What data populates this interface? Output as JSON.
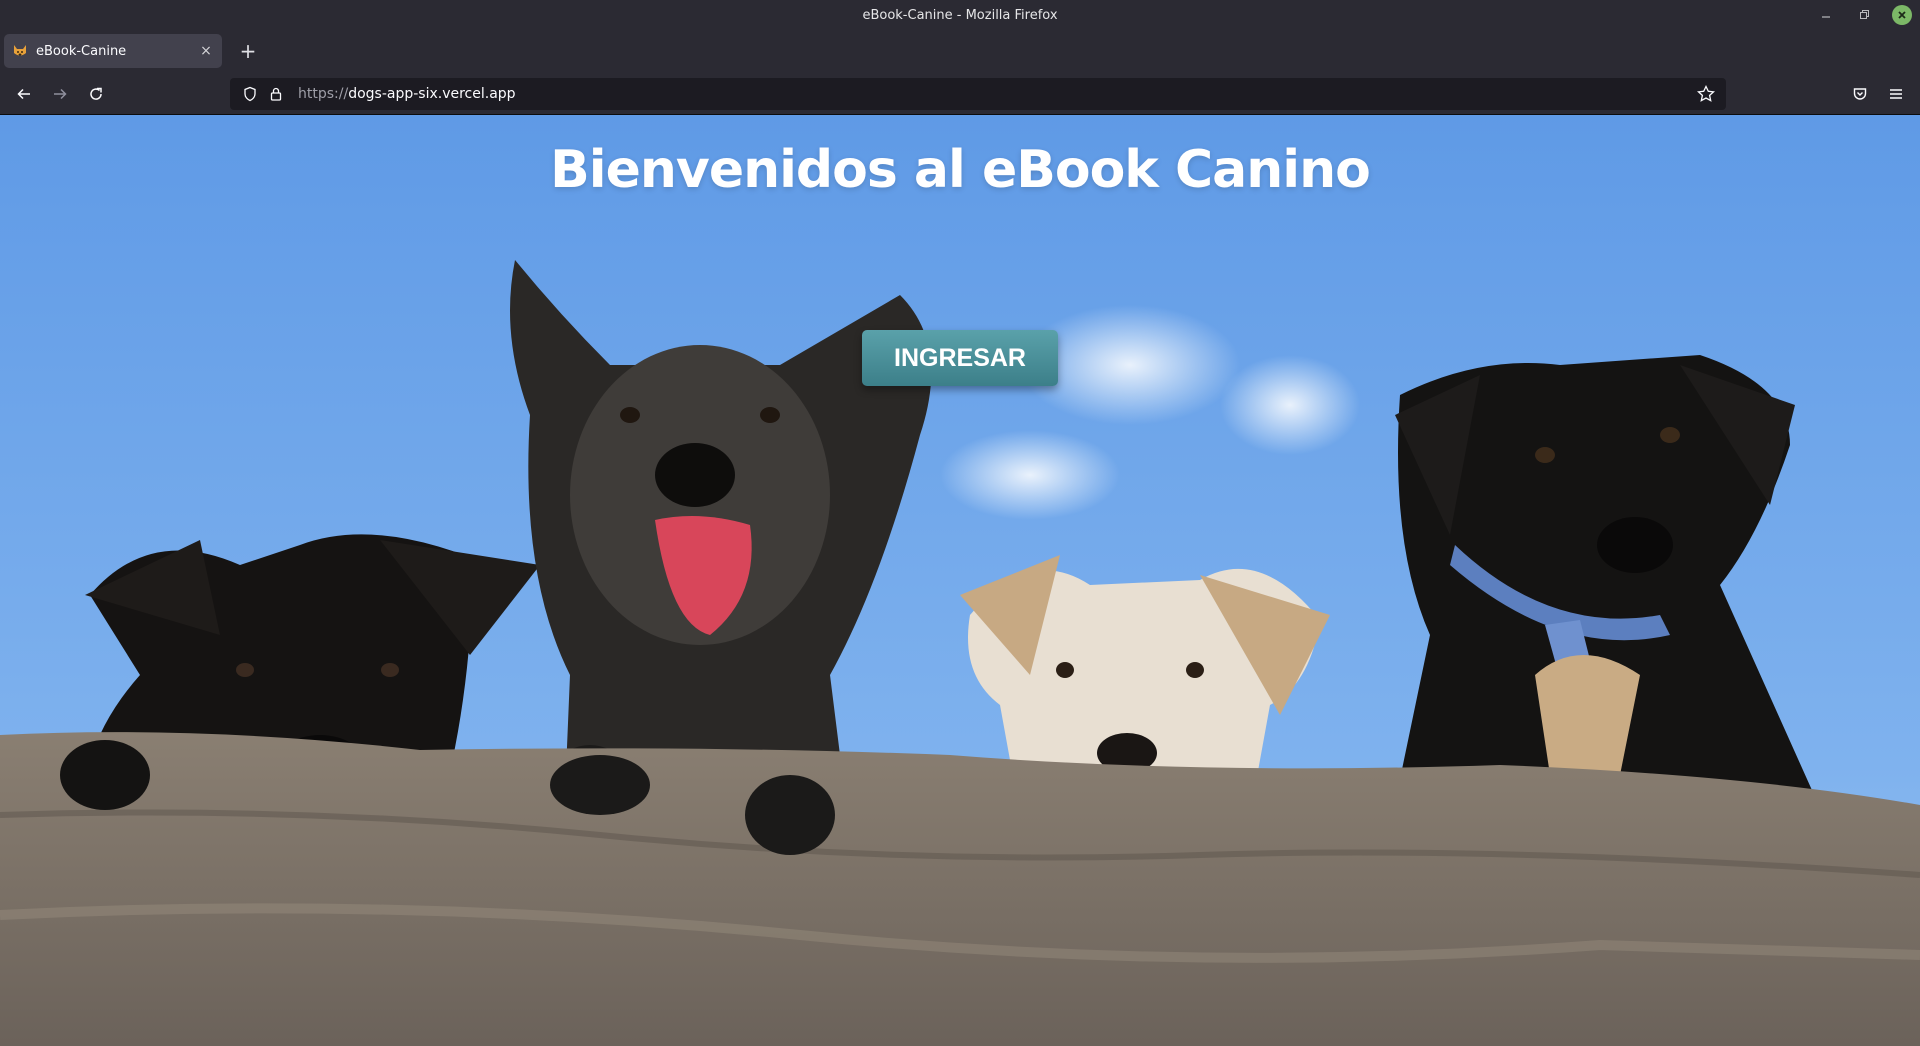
{
  "window": {
    "title": "eBook-Canine - Mozilla Firefox",
    "controls": [
      "minimize-icon",
      "restore-icon",
      "close-icon"
    ]
  },
  "tabs": [
    {
      "label": "eBook-Canine",
      "favicon": "dog-face-icon",
      "close": "×"
    }
  ],
  "new_tab_label": "+",
  "navbar": {
    "back_icon": "arrow-left-icon",
    "forward_icon": "arrow-right-icon",
    "reload_icon": "reload-icon",
    "url_scheme": "https://",
    "url_host": "dogs-app-six.vercel.app",
    "pocket_icon": "pocket-icon",
    "menu_icon": "hamburger-menu-icon"
  },
  "page": {
    "heading": "Bienvenidos al eBook Canino",
    "button_label": "INGRESAR"
  },
  "colors": {
    "sky": "#6fa6e6",
    "button": "#4a8e98",
    "browser_chrome": "#2b2a33"
  }
}
